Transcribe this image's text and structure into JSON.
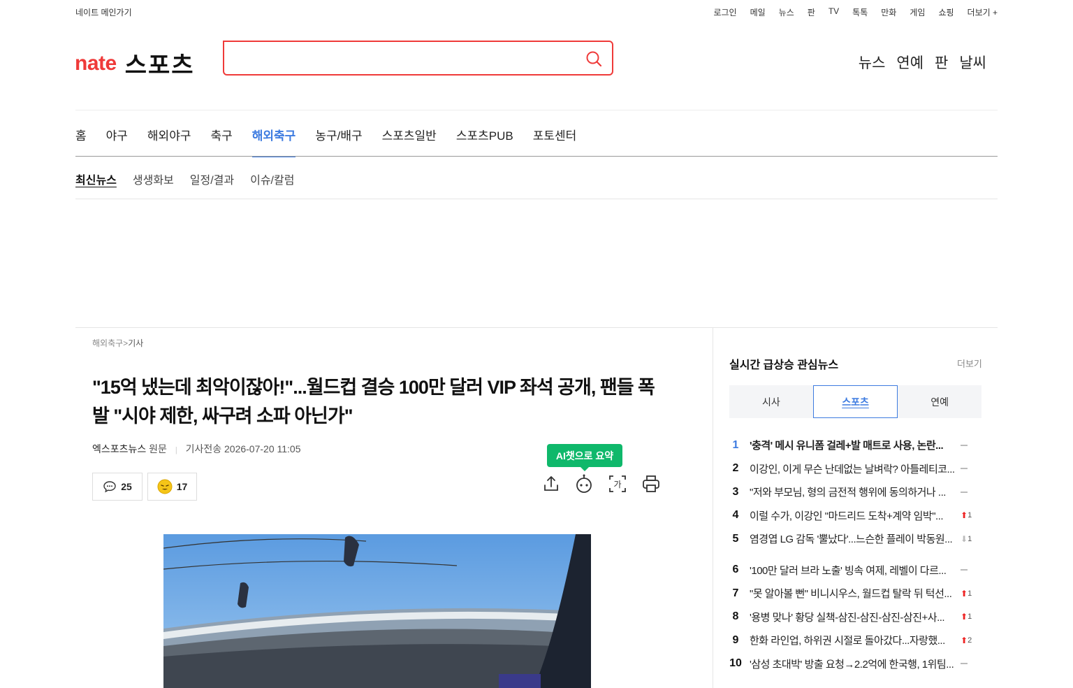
{
  "util": {
    "main_link": "네이트 메인가기",
    "links": [
      "로그인",
      "메일",
      "뉴스",
      "판",
      "TV",
      "톡톡",
      "만화",
      "게임",
      "쇼핑",
      "더보기 +"
    ]
  },
  "header": {
    "logo_nate": "nate",
    "logo_sports": "스포츠",
    "search_value": "",
    "links": [
      "뉴스",
      "연예",
      "판",
      "날씨"
    ]
  },
  "gnb": [
    "홈",
    "야구",
    "해외야구",
    "축구",
    "해외축구",
    "농구/배구",
    "스포츠일반",
    "스포츠PUB",
    "포토센터"
  ],
  "gnb_active": "해외축구",
  "lnb": [
    "최신뉴스",
    "생생화보",
    "일정/결과",
    "이슈/칼럼"
  ],
  "article": {
    "breadcrumb_section": "해외축구",
    "breadcrumb_sep": ">",
    "breadcrumb_page": "기사",
    "title": "\"15억 냈는데 최악이잖아!\"...월드컵 결승 100만 달러 VIP 좌석 공개, 팬들 폭발 \"시야 제한, 싸구려 소파 아닌가\"",
    "source": "엑스포츠뉴스",
    "source_link": "원문",
    "sent_label": "기사전송",
    "sent_time": "2026-07-20 11:05",
    "comment_count": "25",
    "like_count": "17",
    "ai_tip": "AI챗으로 요약"
  },
  "ranking": {
    "title": "실시간 급상승 관심뉴스",
    "more": "더보기",
    "tabs": [
      "시사",
      "스포츠",
      "연예"
    ],
    "active_tab": "스포츠",
    "items": [
      {
        "rank": "1",
        "text": "'충격' 메시 유니폼 걸레+발 매트로 사용, 논란...",
        "change": "-",
        "delta": ""
      },
      {
        "rank": "2",
        "text": "이강인, 이게 무슨 난데없는 날벼락? 아틀레티코...",
        "change": "-",
        "delta": ""
      },
      {
        "rank": "3",
        "text": "\"저와 부모님, 형의 금전적 행위에 동의하거나 ...",
        "change": "-",
        "delta": ""
      },
      {
        "rank": "4",
        "text": "이럴 수가, 이강인 \"마드리드 도착+계약 임박\"...",
        "change": "up",
        "delta": "1"
      },
      {
        "rank": "5",
        "text": "염경엽 LG 감독 '뿔났다'...느슨한 플레이 박동원...",
        "change": "down",
        "delta": "1"
      },
      {
        "rank": "6",
        "text": "'100만 달러 브라 노출' 빙속 여제, 레벨이 다르...",
        "change": "-",
        "delta": ""
      },
      {
        "rank": "7",
        "text": "\"못 알아볼 뻔\" 비니시우스, 월드컵 탈락 뒤 턱선...",
        "change": "up",
        "delta": "1"
      },
      {
        "rank": "8",
        "text": "'용병 맞나' 황당 실책-삼진-삼진-삼진-삼진+사...",
        "change": "up",
        "delta": "1"
      },
      {
        "rank": "9",
        "text": "한화 라인업, 하위권 시절로 돌아갔다...자랑했...",
        "change": "up",
        "delta": "2"
      },
      {
        "rank": "10",
        "text": "'삼성 초대박' 방출 요청→2.2억에 한국행, 1위팀...",
        "change": "-",
        "delta": ""
      }
    ]
  },
  "colors": {
    "brand": "#ef3a39",
    "accent": "#3d7be0",
    "ai_green": "#0fb86b"
  }
}
